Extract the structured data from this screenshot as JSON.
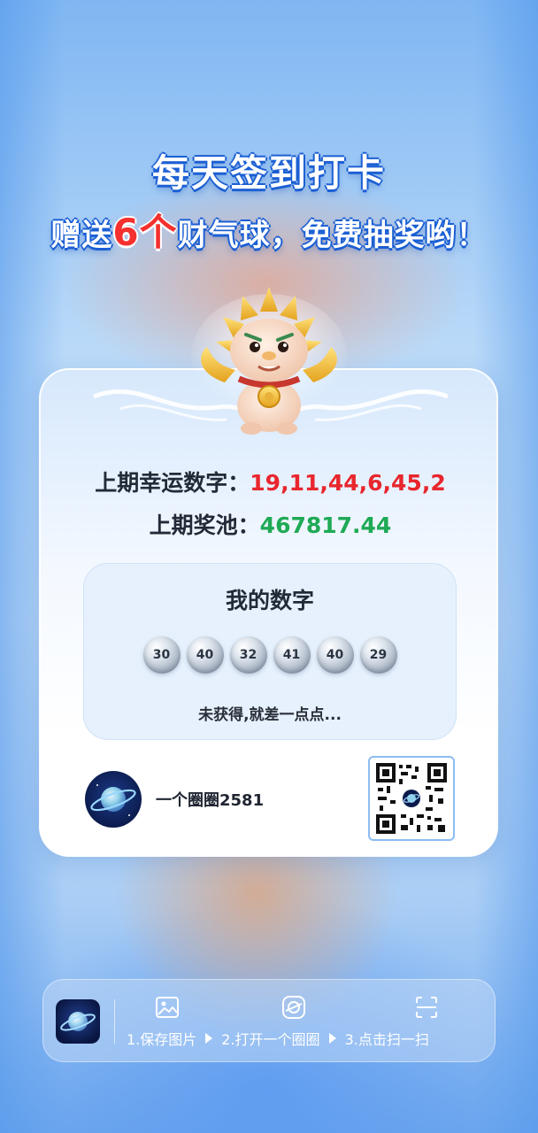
{
  "header": {
    "title": "每天签到打卡",
    "subtitle_before": "赠送",
    "subtitle_highlight": "6个",
    "subtitle_after": "财气球，免费抽奖哟！"
  },
  "card": {
    "lucky_label": "上期幸运数字：",
    "lucky_numbers": "19,11,44,6,45,2",
    "pool_label": "上期奖池：",
    "pool_value": "467817.44",
    "my_numbers_title": "我的数字",
    "my_numbers": [
      "30",
      "40",
      "32",
      "41",
      "40",
      "29"
    ],
    "result_text": "未获得,就差一点点...",
    "user_name": "一个圈圈2581"
  },
  "bottom_bar": {
    "steps": [
      {
        "label": "1.保存图片",
        "icon": "image-icon"
      },
      {
        "label": "2.打开一个圈圈",
        "icon": "app-circle-icon"
      },
      {
        "label": "3.点击扫一扫",
        "icon": "scan-icon"
      }
    ]
  },
  "colors": {
    "lucky": "#e8262d",
    "pool": "#1faa55",
    "title_outline": "#1b5fd4"
  }
}
